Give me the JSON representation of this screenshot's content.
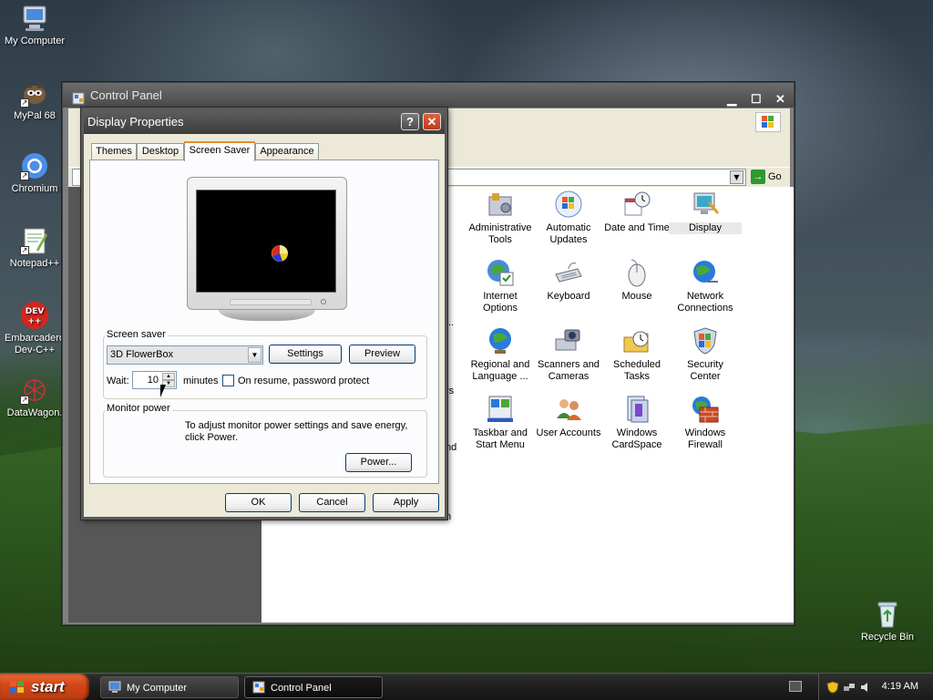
{
  "desktop": {
    "icons": [
      {
        "label": "My Computer",
        "icon": "my-computer-icon"
      },
      {
        "label": "MyPal 68",
        "icon": "mypal-icon"
      },
      {
        "label": "Chromium",
        "icon": "chromium-icon"
      },
      {
        "label": "Notepad++",
        "icon": "notepadpp-icon"
      },
      {
        "label": "Embarcadero Dev-C++",
        "label_line1": "Embarcadero",
        "label_line2": "Dev-C++",
        "icon": "devcpp-icon"
      },
      {
        "label": "DataWagon.",
        "icon": "datawagon-icon"
      },
      {
        "label": "Recycle Bin",
        "icon": "recycle-bin-icon"
      }
    ]
  },
  "taskbar": {
    "start_label": "start",
    "tasks": [
      {
        "label": "My Computer",
        "active": false
      },
      {
        "label": "Control Panel",
        "active": true
      }
    ],
    "clock": "4:19 AM"
  },
  "control_panel": {
    "title": "Control Panel",
    "address_go": "Go",
    "partial_left_texts": [
      "...",
      "rs",
      "nd",
      "n"
    ],
    "items": [
      {
        "label_line1": "Administrative",
        "label_line2": "Tools",
        "icon": "administrative-tools-icon"
      },
      {
        "label_line1": "Automatic",
        "label_line2": "Updates",
        "icon": "automatic-updates-icon"
      },
      {
        "label_line1": "Date and Time",
        "label_line2": "",
        "icon": "date-time-icon"
      },
      {
        "label_line1": "Display",
        "label_line2": "",
        "icon": "display-icon",
        "selected": true
      },
      {
        "label_line1": "Internet",
        "label_line2": "Options",
        "icon": "internet-options-icon"
      },
      {
        "label_line1": "Keyboard",
        "label_line2": "",
        "icon": "keyboard-icon"
      },
      {
        "label_line1": "Mouse",
        "label_line2": "",
        "icon": "mouse-icon"
      },
      {
        "label_line1": "Network",
        "label_line2": "Connections",
        "icon": "network-connections-icon"
      },
      {
        "label_line1": "Regional and",
        "label_line2": "Language ...",
        "icon": "regional-language-icon"
      },
      {
        "label_line1": "Scanners and",
        "label_line2": "Cameras",
        "icon": "scanners-cameras-icon"
      },
      {
        "label_line1": "Scheduled",
        "label_line2": "Tasks",
        "icon": "scheduled-tasks-icon"
      },
      {
        "label_line1": "Security",
        "label_line2": "Center",
        "icon": "security-center-icon"
      },
      {
        "label_line1": "Taskbar and",
        "label_line2": "Start Menu",
        "icon": "taskbar-start-menu-icon"
      },
      {
        "label_line1": "User Accounts",
        "label_line2": "",
        "icon": "user-accounts-icon"
      },
      {
        "label_line1": "Windows",
        "label_line2": "CardSpace",
        "icon": "windows-cardspace-icon"
      },
      {
        "label_line1": "Windows",
        "label_line2": "Firewall",
        "icon": "windows-firewall-icon"
      }
    ]
  },
  "display_properties": {
    "title": "Display Properties",
    "help_label": "?",
    "tabs": [
      "Themes",
      "Desktop",
      "Screen Saver",
      "Appearance"
    ],
    "active_tab": "Screen Saver",
    "screen_saver": {
      "group_label": "Screen saver",
      "selected": "3D FlowerBox",
      "settings_label": "Settings",
      "preview_label": "Preview",
      "wait_label": "Wait:",
      "wait_value": "10",
      "minutes_label": "minutes",
      "password_label": "On resume, password protect",
      "password_checked": false
    },
    "monitor_power": {
      "group_label": "Monitor power",
      "description_line1": "To adjust monitor power settings and save energy,",
      "description_line2": "click Power.",
      "power_label": "Power..."
    },
    "buttons": {
      "ok": "OK",
      "cancel": "Cancel",
      "apply": "Apply"
    }
  }
}
